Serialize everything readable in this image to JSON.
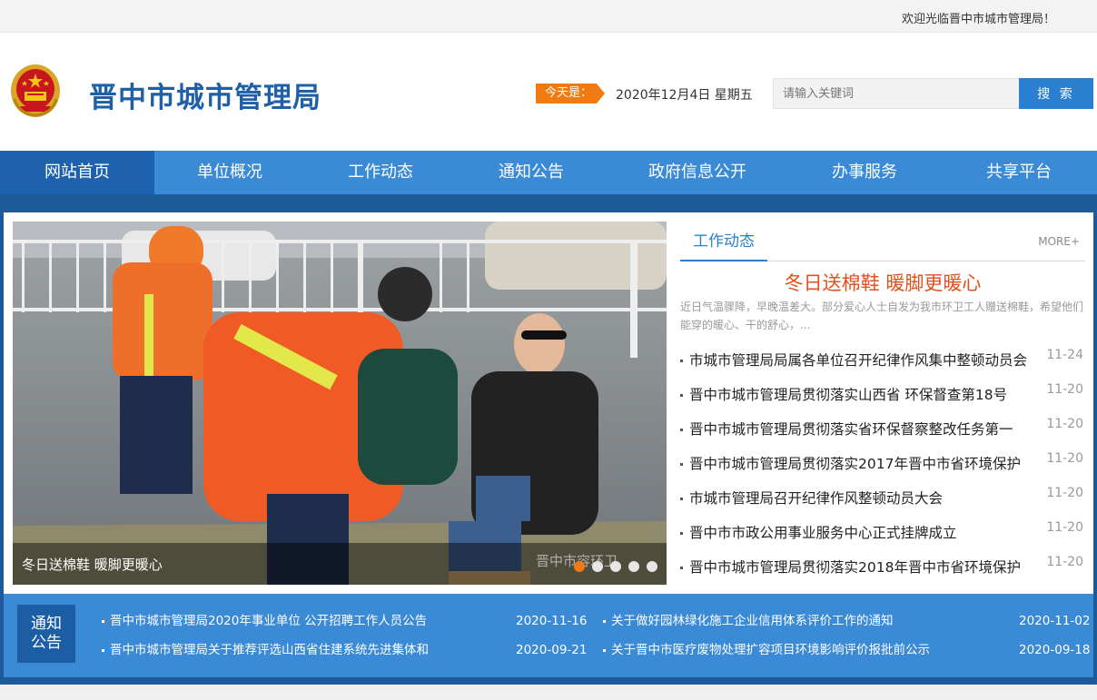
{
  "topbar": {
    "welcome": "欢迎光临晋中市城市管理局！"
  },
  "header": {
    "title": "晋中市城市管理局",
    "today_label": "今天是：",
    "date": "2020年12月4日 星期五",
    "search_placeholder": "请输入关键词",
    "search_button": "搜 索"
  },
  "nav": {
    "items": [
      "网站首页",
      "单位概况",
      "工作动态",
      "通知公告",
      "政府信息公开",
      "办事服务",
      "共享平台"
    ],
    "active_index": 0
  },
  "slider": {
    "caption": "冬日送棉鞋 暖脚更暖心",
    "watermark": "晋中市容环卫",
    "dot_count": 5,
    "active_dot": 0
  },
  "news": {
    "tab": "工作动态",
    "more": "MORE+",
    "headline": "冬日送棉鞋 暖脚更暖心",
    "summary": "近日气温骤降，早晚温差大。部分爱心人士自发为我市环卫工人赠送棉鞋，希望他们能穿的暖心、干的舒心，...",
    "items": [
      {
        "title": "市城市管理局局属各单位召开纪律作风集中整顿动员会",
        "date": "11-24"
      },
      {
        "title": "晋中市城市管理局贯彻落实山西省 环保督查第18号",
        "date": "11-20"
      },
      {
        "title": "晋中市城市管理局贯彻落实省环保督察整改任务第一",
        "date": "11-20"
      },
      {
        "title": "晋中市城市管理局贯彻落实2017年晋中市省环境保护",
        "date": "11-20"
      },
      {
        "title": "市城市管理局召开纪律作风整顿动员大会",
        "date": "11-20"
      },
      {
        "title": "晋中市市政公用事业服务中心正式挂牌成立",
        "date": "11-20"
      },
      {
        "title": "晋中市城市管理局贯彻落实2018年晋中市省环境保护",
        "date": "11-20"
      }
    ]
  },
  "notice": {
    "label_line1": "通知",
    "label_line2": "公告",
    "items": [
      {
        "title": "晋中市城市管理局2020年事业单位 公开招聘工作人员公告",
        "date": "2020-11-16"
      },
      {
        "title": "关于做好园林绿化施工企业信用体系评价工作的通知",
        "date": "2020-11-02"
      },
      {
        "title": "晋中市城市管理局关于推荐评选山西省住建系统先进集体和",
        "date": "2020-09-21"
      },
      {
        "title": "关于晋中市医疗废物处理扩容项目环境影响评价报批前公示",
        "date": "2020-09-18"
      }
    ]
  },
  "colors": {
    "brand_blue": "#1e5fa8",
    "nav_blue": "#3a8ad6",
    "nav_active": "#1e62ad",
    "accent_orange": "#f07b12",
    "headline_red": "#e2501c"
  }
}
